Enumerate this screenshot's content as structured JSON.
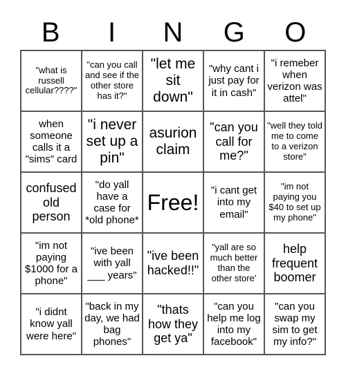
{
  "header": {
    "letters": [
      "B",
      "I",
      "N",
      "G",
      "O"
    ]
  },
  "cells": [
    {
      "text": "\"what is russell cellular????\"",
      "size": "s"
    },
    {
      "text": "\"can you call and see if the other store has it?\"",
      "size": "s"
    },
    {
      "text": "\"let me sit down\"",
      "size": "xl"
    },
    {
      "text": "\"why cant i just pay for it in cash\"",
      "size": "m"
    },
    {
      "text": "\"i remeber when verizon was attel\"",
      "size": "m"
    },
    {
      "text": "when someone calls it a \"sims\" card",
      "size": "m"
    },
    {
      "text": "\"i never set up a pin\"",
      "size": "xl"
    },
    {
      "text": "asurion claim",
      "size": "xl"
    },
    {
      "text": "\"can you call for me?\"",
      "size": "l"
    },
    {
      "text": "\"well they told me to come to a verizon store\"",
      "size": "s"
    },
    {
      "text": "confused old person",
      "size": "l"
    },
    {
      "text": "\"do yall have a case for *old phone*",
      "size": "m"
    },
    {
      "text": "Free!",
      "size": "free"
    },
    {
      "text": "\"i cant get into my email\"",
      "size": "m"
    },
    {
      "text": "\"im not paying you $40 to set up my phone\"",
      "size": "s"
    },
    {
      "text": "\"im not paying $1000 for a phone\"",
      "size": "m"
    },
    {
      "text": "\"ive been with yall ___ years\"",
      "size": "m"
    },
    {
      "text": "\"ive been hacked!!\"",
      "size": "l"
    },
    {
      "text": "\"yall are so much better than the other store'",
      "size": "s"
    },
    {
      "text": "help frequent boomer",
      "size": "l"
    },
    {
      "text": "\"i didnt know yall were here\"",
      "size": "m"
    },
    {
      "text": "\"back in my day, we had bag phones\"",
      "size": "m"
    },
    {
      "text": "\"thats how they get ya\"",
      "size": "l"
    },
    {
      "text": "\"can you help me log into my facebook\"",
      "size": "m"
    },
    {
      "text": "\"can you swap my sim to get my info?\"",
      "size": "m"
    }
  ]
}
